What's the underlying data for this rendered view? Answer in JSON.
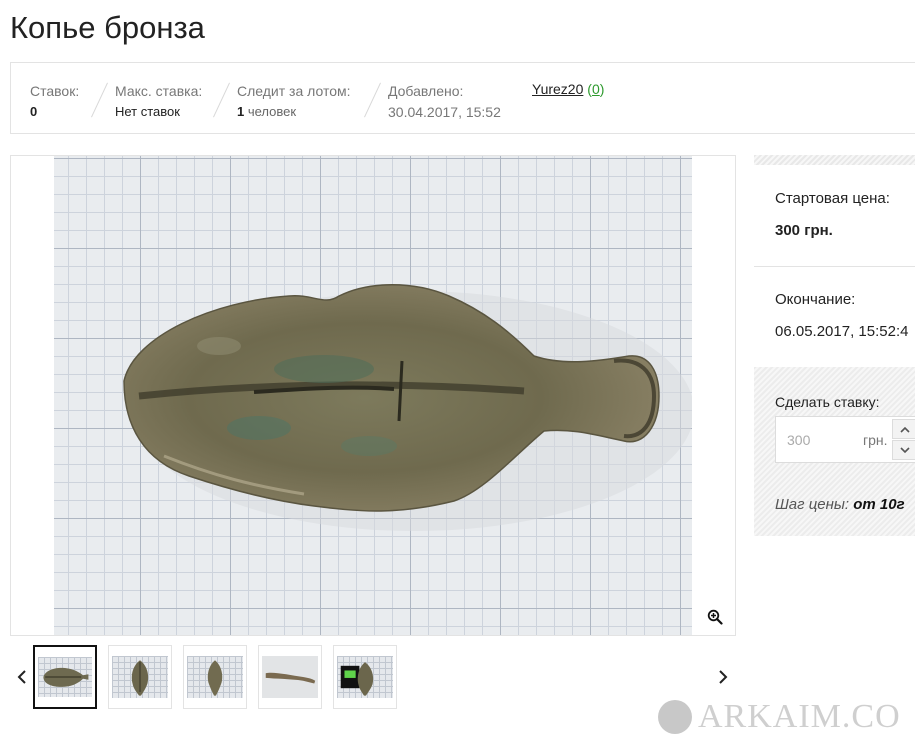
{
  "lot": {
    "title": "Копье бронза"
  },
  "info": {
    "bids_label": "Ставок:",
    "bids_value": "0",
    "max_bid_label": "Макс. ставка:",
    "max_bid_value": "Нет ставок",
    "watching_label": "Следит за лотом:",
    "watching_count": "1",
    "watching_unit": "человек",
    "added_label": "Добавлено:",
    "added_value": "30.04.2017, 15:52",
    "seller_name": "Yurez20",
    "seller_rating_open": "(",
    "seller_rating": "0",
    "seller_rating_close": ")"
  },
  "gallery": {
    "zoom_icon": "zoom-in-icon",
    "prev_icon": "chevron-left-icon",
    "next_icon": "chevron-right-icon",
    "thumbnails": 5,
    "active_thumbnail": 1
  },
  "sidebar": {
    "start_price_label": "Стартовая цена:",
    "start_price_value": "300 грн.",
    "end_label": "Окончание:",
    "end_value": "06.05.2017, 15:52:4",
    "bid_label": "Сделать ставку:",
    "bid_value": "300",
    "bid_currency": "грн.",
    "step_label": "Шаг цены:",
    "step_value": "от 10г"
  },
  "watermark": {
    "text": "ARKAIM.CO"
  },
  "colors": {
    "rating": "#2e9a2e",
    "text": "#222222",
    "border": "#e3e3e3"
  }
}
